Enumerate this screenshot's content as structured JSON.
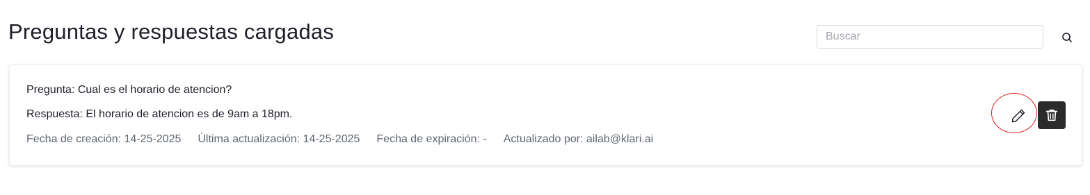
{
  "header": {
    "title": "Preguntas y respuestas cargadas"
  },
  "search": {
    "placeholder": "Buscar",
    "value": "",
    "icon": "search-icon"
  },
  "items": [
    {
      "question": "Pregunta: Cual es el horario de atencion?",
      "answer": "Respuesta: El horario de atencion es de 9am a 18pm.",
      "created": "Fecha de creación: 14-25-2025",
      "updated": "Última actualización: 14-25-2025",
      "expiration": "Fecha de expiración: -",
      "updated_by": "Actualizado por: ailab@klari.ai",
      "edit_icon": "pencil-icon",
      "delete_icon": "trash-icon"
    }
  ],
  "colors": {
    "delete_button_bg": "#2b2b2b",
    "annotation": "#e11d1d"
  }
}
